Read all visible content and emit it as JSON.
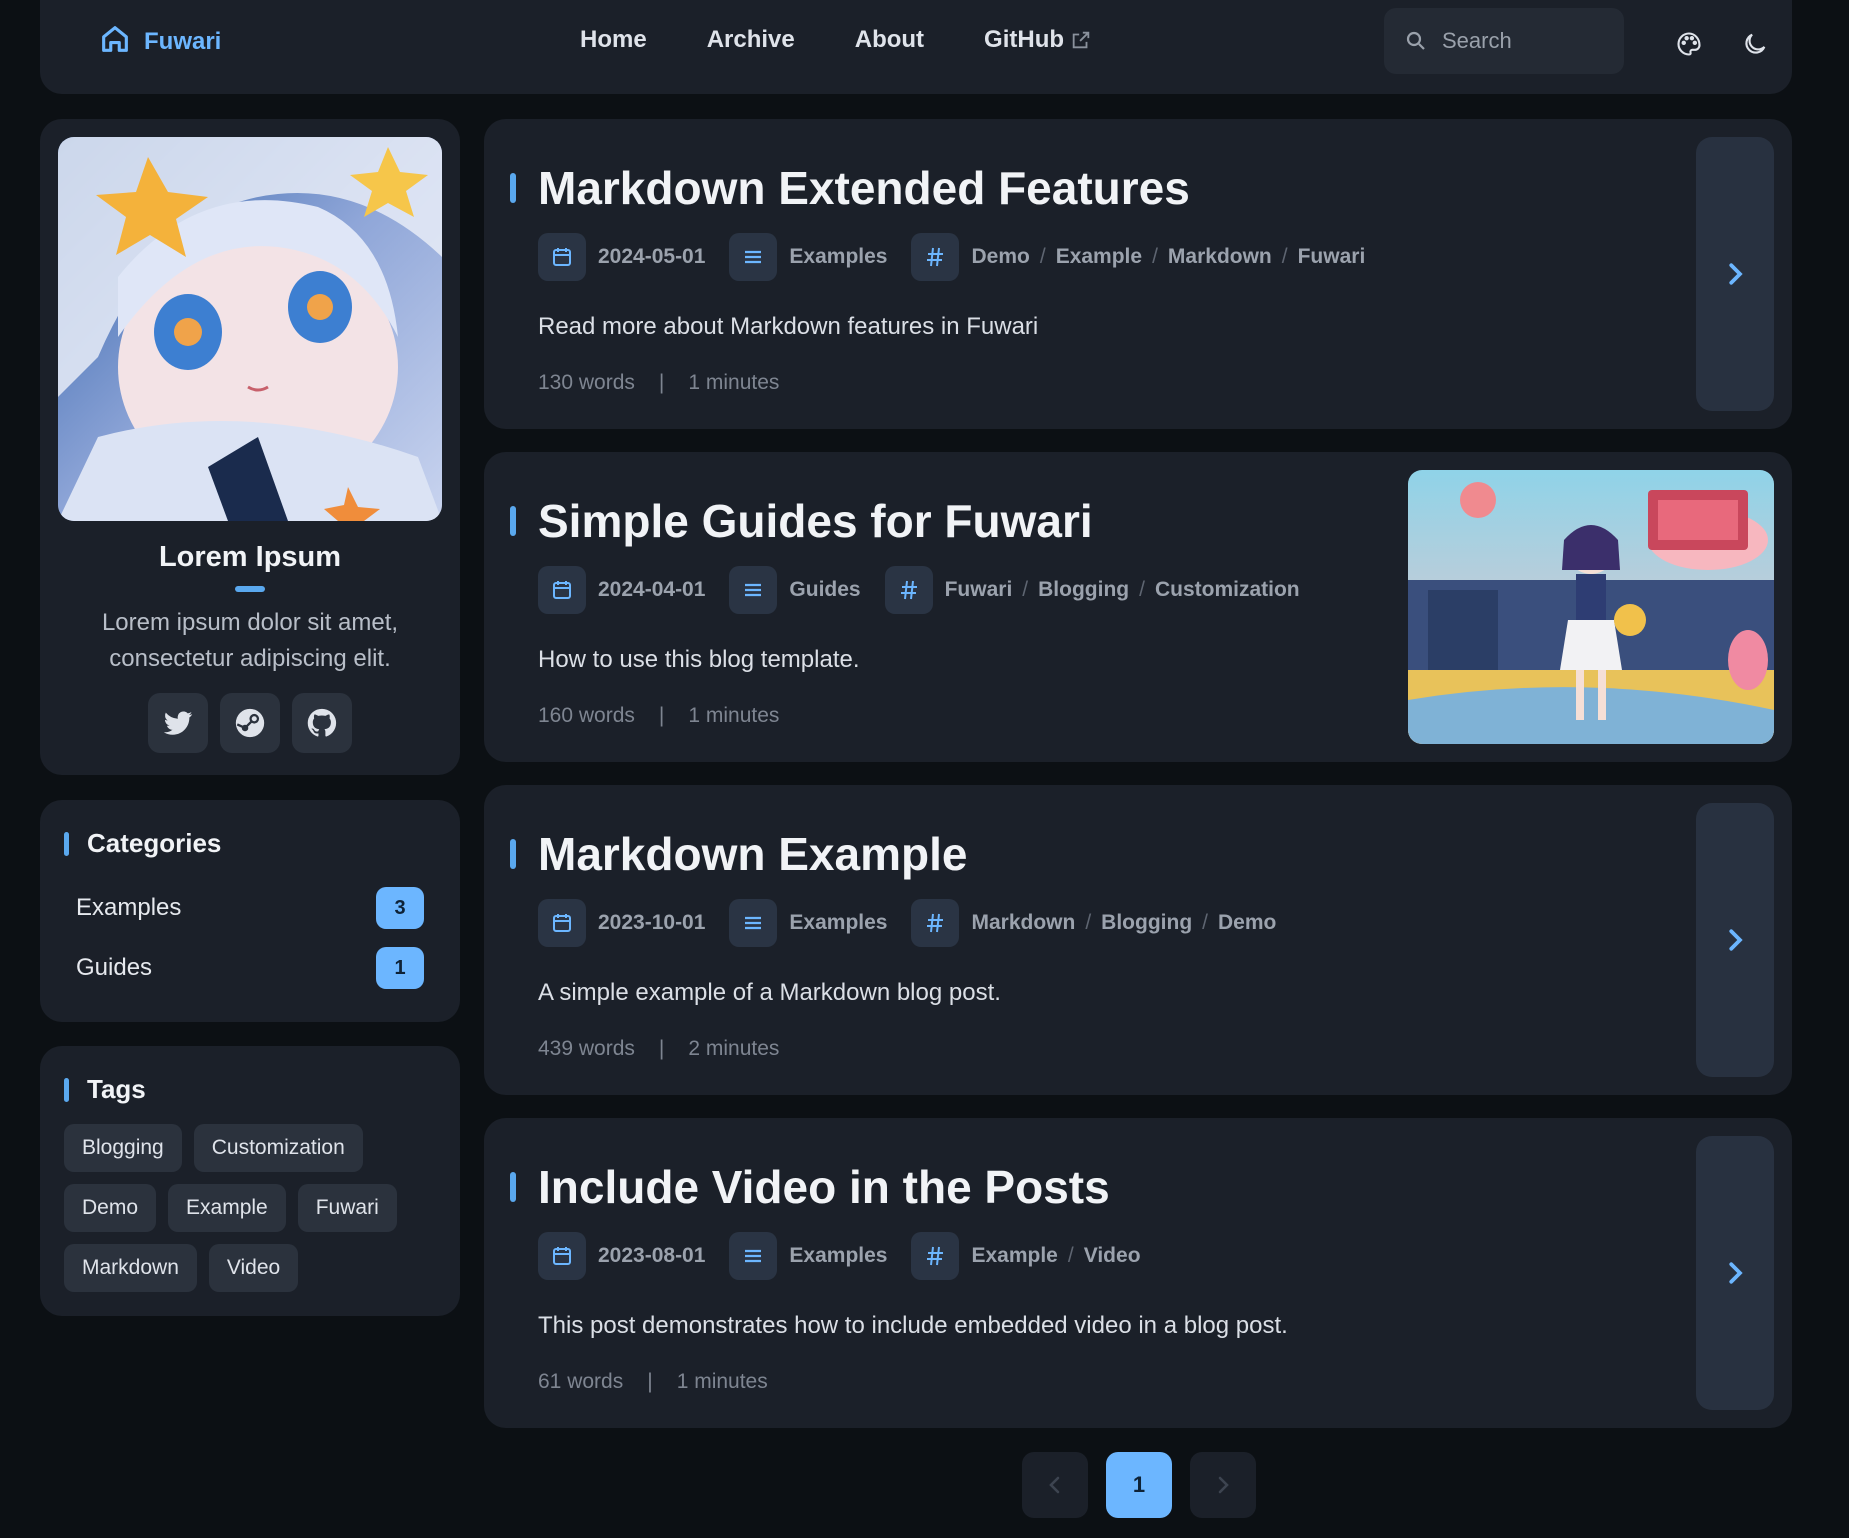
{
  "header": {
    "brand": "Fuwari",
    "nav": [
      {
        "label": "Home"
      },
      {
        "label": "Archive"
      },
      {
        "label": "About"
      },
      {
        "label": "GitHub"
      }
    ],
    "search_placeholder": "Search"
  },
  "profile": {
    "name": "Lorem Ipsum",
    "bio": "Lorem ipsum dolor sit amet, consectetur adipiscing elit.",
    "socials": [
      "twitter-icon",
      "steam-icon",
      "github-icon"
    ]
  },
  "categories": {
    "title": "Categories",
    "items": [
      {
        "label": "Examples",
        "count": "3"
      },
      {
        "label": "Guides",
        "count": "1"
      }
    ]
  },
  "tags": {
    "title": "Tags",
    "items": [
      "Blogging",
      "Customization",
      "Demo",
      "Example",
      "Fuwari",
      "Markdown",
      "Video"
    ]
  },
  "posts": [
    {
      "title": "Markdown Extended Features",
      "date": "2024-05-01",
      "category": "Examples",
      "tags": [
        "Demo",
        "Example",
        "Markdown",
        "Fuwari"
      ],
      "description": "Read more about Markdown features in Fuwari",
      "words": "130 words",
      "minutes": "1 minutes"
    },
    {
      "title": "Simple Guides for Fuwari",
      "date": "2024-04-01",
      "category": "Guides",
      "tags": [
        "Fuwari",
        "Blogging",
        "Customization"
      ],
      "description": "How to use this blog template.",
      "words": "160 words",
      "minutes": "1 minutes"
    },
    {
      "title": "Markdown Example",
      "date": "2023-10-01",
      "category": "Examples",
      "tags": [
        "Markdown",
        "Blogging",
        "Demo"
      ],
      "description": "A simple example of a Markdown blog post.",
      "words": "439 words",
      "minutes": "2 minutes"
    },
    {
      "title": "Include Video in the Posts",
      "date": "2023-08-01",
      "category": "Examples",
      "tags": [
        "Example",
        "Video"
      ],
      "description": "This post demonstrates how to include embedded video in a blog post.",
      "words": "61 words",
      "minutes": "1 minutes"
    }
  ],
  "pagination": {
    "current": "1"
  },
  "colors": {
    "accent": "#6cb6ff",
    "card": "#1b2029",
    "background": "#0c1014"
  }
}
